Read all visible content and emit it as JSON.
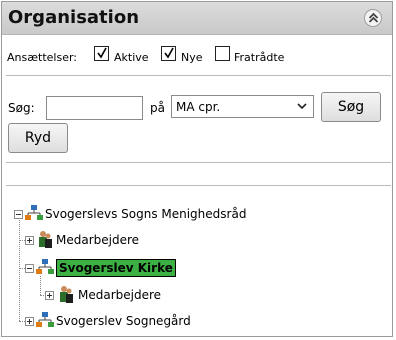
{
  "panel": {
    "title": "Organisation"
  },
  "filters": {
    "label": "Ansættelser:",
    "options": [
      {
        "label": "Aktive",
        "checked": true
      },
      {
        "label": "Nye",
        "checked": true
      },
      {
        "label": "Fratrådte",
        "checked": false
      }
    ]
  },
  "search": {
    "label": "Søg:",
    "value": "",
    "on_label": "på",
    "field_selected": "MA cpr.",
    "search_button": "Søg",
    "clear_button": "Ryd"
  },
  "tree": {
    "nodes": [
      {
        "label": "Svogerslevs Sogns Menighedsråd",
        "icon": "organization-icon",
        "expanded": true,
        "selected": false
      },
      {
        "label": "Medarbejdere",
        "icon": "employees-icon",
        "expanded": false,
        "selected": false
      },
      {
        "label": "Svogerslev Kirke",
        "icon": "organization-icon",
        "expanded": true,
        "selected": true
      },
      {
        "label": "Medarbejdere",
        "icon": "employees-icon",
        "expanded": false,
        "selected": false
      },
      {
        "label": "Svogerslev Sognegård",
        "icon": "organization-icon",
        "expanded": false,
        "selected": false
      }
    ]
  },
  "colors": {
    "selected_bg": "#3cb043",
    "header_bg": "#d3d3d3"
  }
}
